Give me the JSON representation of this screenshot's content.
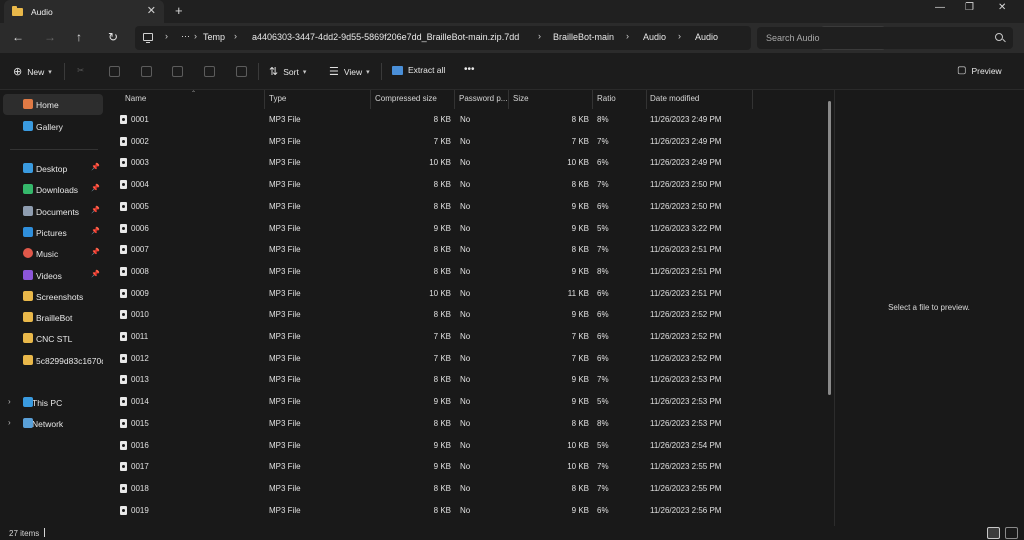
{
  "window": {
    "tab_title": "Audio",
    "close_tab": "✕",
    "new_tab": "+",
    "minimize": "—",
    "maximize": "❐",
    "close": "✕"
  },
  "address": {
    "crumbs": [
      "Temp",
      "a4406303-3447-4dd2-9d55-5869f206e7dd_BrailleBot-main.zip.7dd",
      "BrailleBot-main",
      "Audio",
      "Audio"
    ],
    "more": "···",
    "sep": "›",
    "search_placeholder": "Search Audio"
  },
  "commands": {
    "new": "New",
    "sort": "Sort",
    "view": "View",
    "extract_all": "Extract all",
    "more": "•••",
    "preview": "Preview"
  },
  "sidebar": {
    "home": "Home",
    "gallery": "Gallery",
    "items": [
      {
        "label": "Desktop",
        "color": "#3a9be0"
      },
      {
        "label": "Downloads",
        "color": "#35b86b"
      },
      {
        "label": "Documents",
        "color": "#8f9db0"
      },
      {
        "label": "Pictures",
        "color": "#2f8fdc"
      },
      {
        "label": "Music",
        "color": "#e0584a"
      },
      {
        "label": "Videos",
        "color": "#8c56d8"
      },
      {
        "label": "Screenshots",
        "color": "#e9b84a"
      },
      {
        "label": "BrailleBot",
        "color": "#e9b84a"
      },
      {
        "label": "CNC STL",
        "color": "#e9b84a"
      },
      {
        "label": "5c8299d83c1670d1",
        "color": "#e9b84a"
      }
    ],
    "this_pc": "This PC",
    "network": "Network"
  },
  "columns": {
    "name": "Name",
    "type": "Type",
    "compressed": "Compressed size",
    "password": "Password p...",
    "size": "Size",
    "ratio": "Ratio",
    "date": "Date modified"
  },
  "files": [
    {
      "name": "0001",
      "type": "MP3 File",
      "compressed": "8 KB",
      "password": "No",
      "size": "8 KB",
      "ratio": "8%",
      "date": "11/26/2023 2:49 PM"
    },
    {
      "name": "0002",
      "type": "MP3 File",
      "compressed": "7 KB",
      "password": "No",
      "size": "7 KB",
      "ratio": "7%",
      "date": "11/26/2023 2:49 PM"
    },
    {
      "name": "0003",
      "type": "MP3 File",
      "compressed": "10 KB",
      "password": "No",
      "size": "10 KB",
      "ratio": "6%",
      "date": "11/26/2023 2:49 PM"
    },
    {
      "name": "0004",
      "type": "MP3 File",
      "compressed": "8 KB",
      "password": "No",
      "size": "8 KB",
      "ratio": "7%",
      "date": "11/26/2023 2:50 PM"
    },
    {
      "name": "0005",
      "type": "MP3 File",
      "compressed": "8 KB",
      "password": "No",
      "size": "9 KB",
      "ratio": "6%",
      "date": "11/26/2023 2:50 PM"
    },
    {
      "name": "0006",
      "type": "MP3 File",
      "compressed": "9 KB",
      "password": "No",
      "size": "9 KB",
      "ratio": "5%",
      "date": "11/26/2023 3:22 PM"
    },
    {
      "name": "0007",
      "type": "MP3 File",
      "compressed": "8 KB",
      "password": "No",
      "size": "8 KB",
      "ratio": "7%",
      "date": "11/26/2023 2:51 PM"
    },
    {
      "name": "0008",
      "type": "MP3 File",
      "compressed": "8 KB",
      "password": "No",
      "size": "9 KB",
      "ratio": "8%",
      "date": "11/26/2023 2:51 PM"
    },
    {
      "name": "0009",
      "type": "MP3 File",
      "compressed": "10 KB",
      "password": "No",
      "size": "11 KB",
      "ratio": "6%",
      "date": "11/26/2023 2:51 PM"
    },
    {
      "name": "0010",
      "type": "MP3 File",
      "compressed": "8 KB",
      "password": "No",
      "size": "9 KB",
      "ratio": "6%",
      "date": "11/26/2023 2:52 PM"
    },
    {
      "name": "0011",
      "type": "MP3 File",
      "compressed": "7 KB",
      "password": "No",
      "size": "7 KB",
      "ratio": "6%",
      "date": "11/26/2023 2:52 PM"
    },
    {
      "name": "0012",
      "type": "MP3 File",
      "compressed": "7 KB",
      "password": "No",
      "size": "7 KB",
      "ratio": "6%",
      "date": "11/26/2023 2:52 PM"
    },
    {
      "name": "0013",
      "type": "MP3 File",
      "compressed": "8 KB",
      "password": "No",
      "size": "9 KB",
      "ratio": "7%",
      "date": "11/26/2023 2:53 PM"
    },
    {
      "name": "0014",
      "type": "MP3 File",
      "compressed": "9 KB",
      "password": "No",
      "size": "9 KB",
      "ratio": "5%",
      "date": "11/26/2023 2:53 PM"
    },
    {
      "name": "0015",
      "type": "MP3 File",
      "compressed": "8 KB",
      "password": "No",
      "size": "8 KB",
      "ratio": "8%",
      "date": "11/26/2023 2:53 PM"
    },
    {
      "name": "0016",
      "type": "MP3 File",
      "compressed": "9 KB",
      "password": "No",
      "size": "10 KB",
      "ratio": "5%",
      "date": "11/26/2023 2:54 PM"
    },
    {
      "name": "0017",
      "type": "MP3 File",
      "compressed": "9 KB",
      "password": "No",
      "size": "10 KB",
      "ratio": "7%",
      "date": "11/26/2023 2:55 PM"
    },
    {
      "name": "0018",
      "type": "MP3 File",
      "compressed": "8 KB",
      "password": "No",
      "size": "8 KB",
      "ratio": "7%",
      "date": "11/26/2023 2:55 PM"
    },
    {
      "name": "0019",
      "type": "MP3 File",
      "compressed": "8 KB",
      "password": "No",
      "size": "9 KB",
      "ratio": "6%",
      "date": "11/26/2023 2:56 PM"
    }
  ],
  "preview": {
    "message": "Select a file to preview."
  },
  "status": {
    "item_count": "27 items"
  }
}
